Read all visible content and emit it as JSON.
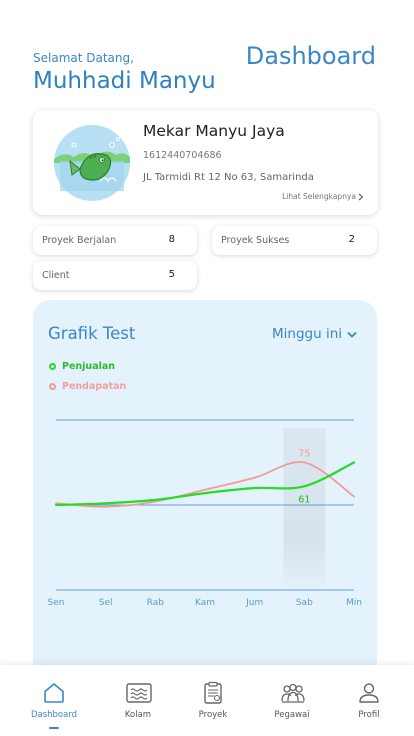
{
  "header": {
    "greeting": "Selamat Datang,",
    "user_name": "Muhhadi Manyu",
    "page_title": "Dashboard"
  },
  "company": {
    "name": "Mekar Manyu Jaya",
    "phone": "1612440704686",
    "address": "JL Tarmidi Rt 12 No 63, Samarinda",
    "more_link": "Lihat Selengkapnya"
  },
  "stats": [
    {
      "label": "Proyek Berjalan",
      "value": "8"
    },
    {
      "label": "Proyek Sukses",
      "value": "2"
    },
    {
      "label": "Client",
      "value": "5"
    }
  ],
  "chart": {
    "title": "Grafik Test",
    "period": "Minggu ini",
    "legend": [
      {
        "name": "Penjualan",
        "color": "#22dd22"
      },
      {
        "name": "Pendapatan",
        "color": "#f19c9c"
      }
    ]
  },
  "chart_data": {
    "type": "line",
    "title": "Grafik Test",
    "categories": [
      "Sen",
      "Sel",
      "Rab",
      "Kam",
      "Jum",
      "Sab",
      "Min"
    ],
    "series": [
      {
        "name": "Penjualan",
        "values": [
          50,
          51,
          53,
          57,
          60,
          61,
          75
        ],
        "color": "#22dd22"
      },
      {
        "name": "Pendapatan",
        "values": [
          51,
          49,
          52,
          59,
          66,
          75,
          55
        ],
        "color": "#f19c9c"
      }
    ],
    "highlight_index": 5,
    "data_labels": [
      {
        "series": "Pendapatan",
        "index": 5,
        "text": "75"
      },
      {
        "series": "Penjualan",
        "index": 5,
        "text": "61"
      }
    ],
    "ylim": [
      0,
      100
    ],
    "grid": true
  },
  "nav": {
    "items": [
      {
        "label": "Dashboard",
        "icon": "home-icon",
        "active": true
      },
      {
        "label": "Kolam",
        "icon": "pond-icon",
        "active": false
      },
      {
        "label": "Proyek",
        "icon": "project-icon",
        "active": false
      },
      {
        "label": "Pegawai",
        "icon": "employees-icon",
        "active": false
      },
      {
        "label": "Profil",
        "icon": "profile-icon",
        "active": false
      }
    ]
  }
}
